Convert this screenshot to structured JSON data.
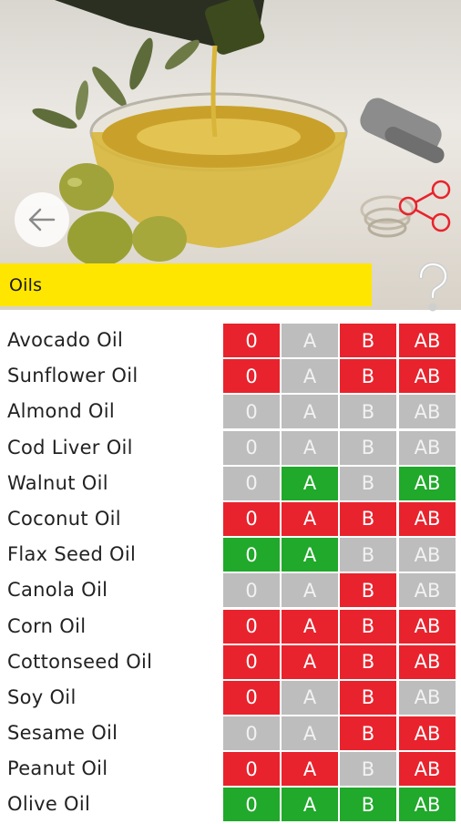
{
  "header": {
    "category": "Oils",
    "back_icon": "arrow-left-icon",
    "share_icon": "share-icon",
    "help_icon": "question-mark-icon",
    "hero_image": "olive-oil-bowl-photo"
  },
  "colors": {
    "avoid": "#e8232d",
    "neutral": "#bdbdbd",
    "beneficial": "#20a92a",
    "banner": "#ffe600"
  },
  "blood_types": [
    "0",
    "A",
    "B",
    "AB"
  ],
  "items": [
    {
      "name": "Avocado Oil",
      "ratings": [
        "avoid",
        "neutral",
        "avoid",
        "avoid"
      ]
    },
    {
      "name": "Sunflower Oil",
      "ratings": [
        "avoid",
        "neutral",
        "avoid",
        "avoid"
      ]
    },
    {
      "name": "Almond Oil",
      "ratings": [
        "neutral",
        "neutral",
        "neutral",
        "neutral"
      ]
    },
    {
      "name": "Cod Liver Oil",
      "ratings": [
        "neutral",
        "neutral",
        "neutral",
        "neutral"
      ]
    },
    {
      "name": "Walnut Oil",
      "ratings": [
        "neutral",
        "beneficial",
        "neutral",
        "beneficial"
      ]
    },
    {
      "name": "Coconut Oil",
      "ratings": [
        "avoid",
        "avoid",
        "avoid",
        "avoid"
      ]
    },
    {
      "name": "Flax Seed Oil",
      "ratings": [
        "beneficial",
        "beneficial",
        "neutral",
        "neutral"
      ]
    },
    {
      "name": "Canola Oil",
      "ratings": [
        "neutral",
        "neutral",
        "avoid",
        "neutral"
      ]
    },
    {
      "name": "Corn Oil",
      "ratings": [
        "avoid",
        "avoid",
        "avoid",
        "avoid"
      ]
    },
    {
      "name": "Cottonseed Oil",
      "ratings": [
        "avoid",
        "avoid",
        "avoid",
        "avoid"
      ]
    },
    {
      "name": "Soy Oil",
      "ratings": [
        "avoid",
        "neutral",
        "avoid",
        "neutral"
      ]
    },
    {
      "name": "Sesame Oil",
      "ratings": [
        "neutral",
        "neutral",
        "avoid",
        "avoid"
      ]
    },
    {
      "name": "Peanut Oil",
      "ratings": [
        "avoid",
        "avoid",
        "neutral",
        "avoid"
      ]
    },
    {
      "name": "Olive Oil",
      "ratings": [
        "beneficial",
        "beneficial",
        "beneficial",
        "beneficial"
      ]
    }
  ]
}
